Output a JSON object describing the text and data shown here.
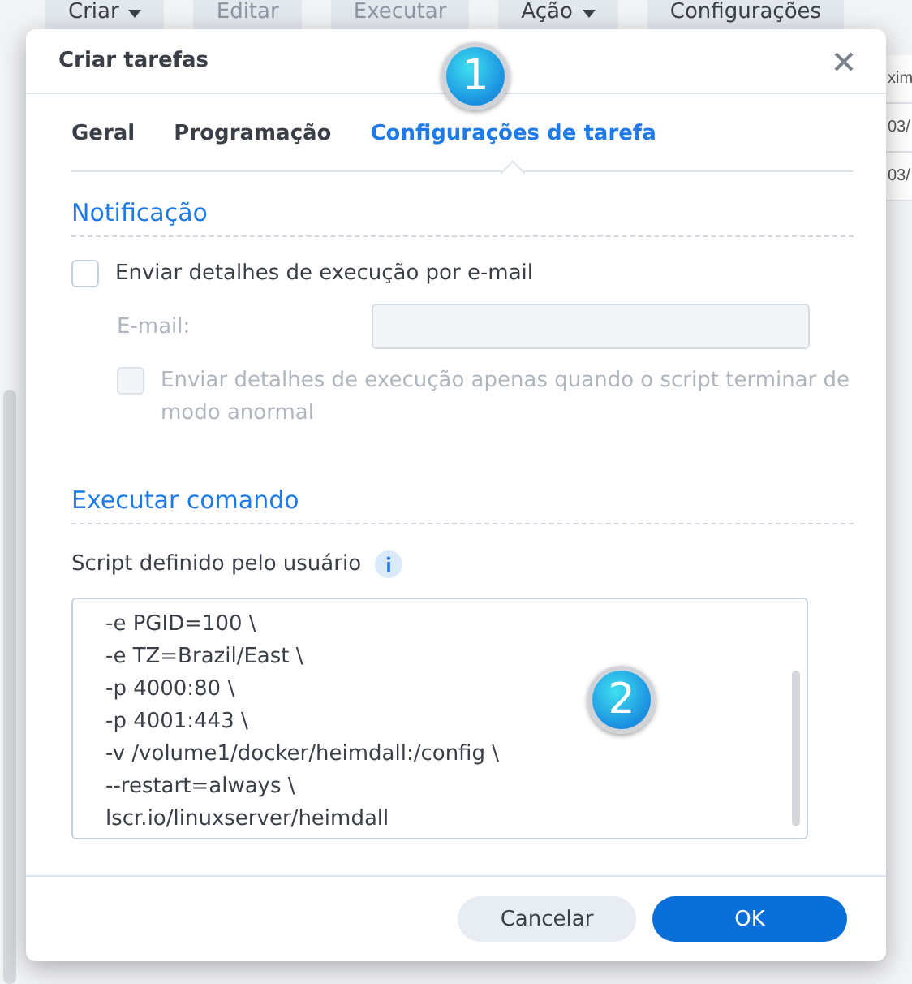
{
  "toolbar": [
    {
      "label": "Criar",
      "dropdown": true,
      "disabled": false
    },
    {
      "label": "Editar",
      "dropdown": false,
      "disabled": true
    },
    {
      "label": "Executar",
      "dropdown": false,
      "disabled": true
    },
    {
      "label": "Ação",
      "dropdown": true,
      "disabled": false
    },
    {
      "label": "Configurações",
      "dropdown": false,
      "disabled": false
    }
  ],
  "background_table": {
    "cells": [
      "xim",
      "03/",
      "03/"
    ]
  },
  "dialog": {
    "title": "Criar tarefas",
    "tabs": [
      {
        "label": "Geral",
        "selected": false
      },
      {
        "label": "Programação",
        "selected": false
      },
      {
        "label": "Configurações de tarefa",
        "selected": true
      }
    ],
    "notification": {
      "heading": "Notificação",
      "email_checkbox": {
        "label": "Enviar detalhes de execução por e-mail",
        "checked": false,
        "disabled": false
      },
      "email_field": {
        "label": "E-mail:",
        "disabled": true
      },
      "abnormal_checkbox": {
        "label": "Enviar detalhes de execução apenas quando o script terminar de modo anormal",
        "checked": false,
        "disabled": true
      }
    },
    "command": {
      "heading": "Executar comando",
      "script_label": "Script definido pelo usuário",
      "script_lines": [
        "-e PGID=100 \\",
        "-e TZ=Brazil/East \\",
        "-p 4000:80 \\",
        "-p 4001:443 \\",
        "-v /volume1/docker/heimdall:/config \\",
        "--restart=always \\",
        "lscr.io/linuxserver/heimdall"
      ]
    },
    "buttons": [
      {
        "label": "Cancelar",
        "kind": "secondary"
      },
      {
        "label": "OK",
        "kind": "primary"
      }
    ]
  },
  "annotations": [
    {
      "label": "1"
    },
    {
      "label": "2"
    }
  ]
}
